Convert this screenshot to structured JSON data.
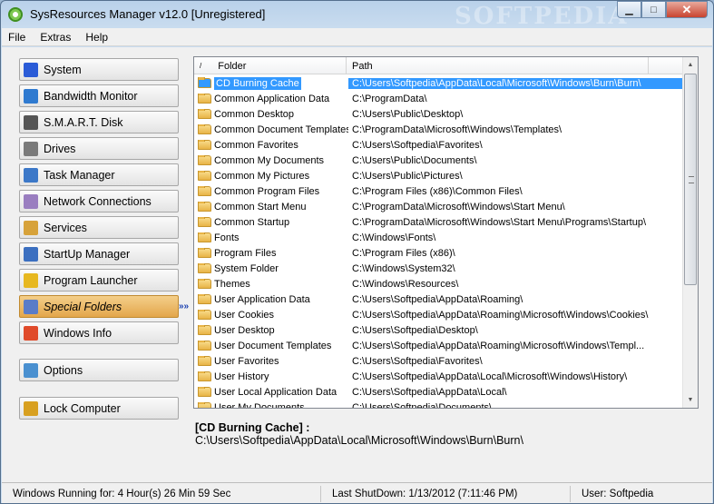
{
  "window": {
    "title": "SysResources Manager  v12.0 [Unregistered]",
    "watermark": "SOFTPEDIA",
    "minimize": "▁",
    "maximize": "□",
    "close": "✕"
  },
  "menu": [
    "File",
    "Extras",
    "Help"
  ],
  "nav": [
    {
      "label": "System",
      "color": "#2a5bd7"
    },
    {
      "label": "Bandwidth Monitor",
      "color": "#2f7ad0"
    },
    {
      "label": "S.M.A.R.T. Disk",
      "color": "#555555"
    },
    {
      "label": "Drives",
      "color": "#7a7a7a"
    },
    {
      "label": "Task Manager",
      "color": "#3c78c8"
    },
    {
      "label": "Network Connections",
      "color": "#9a7ec0"
    },
    {
      "label": "Services",
      "color": "#d7a23a"
    },
    {
      "label": "StartUp Manager",
      "color": "#3b6fc0"
    },
    {
      "label": "Program Launcher",
      "color": "#e7b820"
    },
    {
      "label": "Special Folders",
      "color": "#5a7cc8"
    },
    {
      "label": "Windows Info",
      "color": "#e04a2a"
    },
    {
      "label": "Options",
      "color": "#4a90d0"
    },
    {
      "label": "Lock Computer",
      "color": "#d8a020"
    }
  ],
  "arrow": "»»",
  "list": {
    "sort_glyph": "/",
    "col_folder": "Folder",
    "col_path": "Path",
    "rows": [
      {
        "folder": "CD Burning Cache",
        "path": "C:\\Users\\Softpedia\\AppData\\Local\\Microsoft\\Windows\\Burn\\Burn\\"
      },
      {
        "folder": "Common Application Data",
        "path": "C:\\ProgramData\\"
      },
      {
        "folder": "Common Desktop",
        "path": "C:\\Users\\Public\\Desktop\\"
      },
      {
        "folder": "Common Document Templates",
        "path": "C:\\ProgramData\\Microsoft\\Windows\\Templates\\"
      },
      {
        "folder": "Common Favorites",
        "path": "C:\\Users\\Softpedia\\Favorites\\"
      },
      {
        "folder": "Common My Documents",
        "path": "C:\\Users\\Public\\Documents\\"
      },
      {
        "folder": "Common My Pictures",
        "path": "C:\\Users\\Public\\Pictures\\"
      },
      {
        "folder": "Common Program Files",
        "path": "C:\\Program Files (x86)\\Common Files\\"
      },
      {
        "folder": "Common Start Menu",
        "path": "C:\\ProgramData\\Microsoft\\Windows\\Start Menu\\"
      },
      {
        "folder": "Common Startup",
        "path": "C:\\ProgramData\\Microsoft\\Windows\\Start Menu\\Programs\\Startup\\"
      },
      {
        "folder": "Fonts",
        "path": "C:\\Windows\\Fonts\\"
      },
      {
        "folder": "Program Files",
        "path": "C:\\Program Files (x86)\\"
      },
      {
        "folder": "System Folder",
        "path": "C:\\Windows\\System32\\"
      },
      {
        "folder": "Themes",
        "path": "C:\\Windows\\Resources\\"
      },
      {
        "folder": "User Application Data",
        "path": "C:\\Users\\Softpedia\\AppData\\Roaming\\"
      },
      {
        "folder": "User Cookies",
        "path": "C:\\Users\\Softpedia\\AppData\\Roaming\\Microsoft\\Windows\\Cookies\\"
      },
      {
        "folder": "User Desktop",
        "path": "C:\\Users\\Softpedia\\Desktop\\"
      },
      {
        "folder": "User Document Templates",
        "path": "C:\\Users\\Softpedia\\AppData\\Roaming\\Microsoft\\Windows\\Templ..."
      },
      {
        "folder": "User Favorites",
        "path": "C:\\Users\\Softpedia\\Favorites\\"
      },
      {
        "folder": "User History",
        "path": "C:\\Users\\Softpedia\\AppData\\Local\\Microsoft\\Windows\\History\\"
      },
      {
        "folder": "User Local Application Data",
        "path": "C:\\Users\\Softpedia\\AppData\\Local\\"
      },
      {
        "folder": "User My Documents",
        "path": "C:\\Users\\Softpedia\\Documents\\"
      }
    ]
  },
  "detail": {
    "title": "[CD Burning Cache] :",
    "path": "C:\\Users\\Softpedia\\AppData\\Local\\Microsoft\\Windows\\Burn\\Burn\\"
  },
  "status": {
    "running": "Windows Running for: 4 Hour(s) 26 Min 59 Sec",
    "shutdown": "Last ShutDown: 1/13/2012 (7:11:46 PM)",
    "user": "User: Softpedia"
  }
}
